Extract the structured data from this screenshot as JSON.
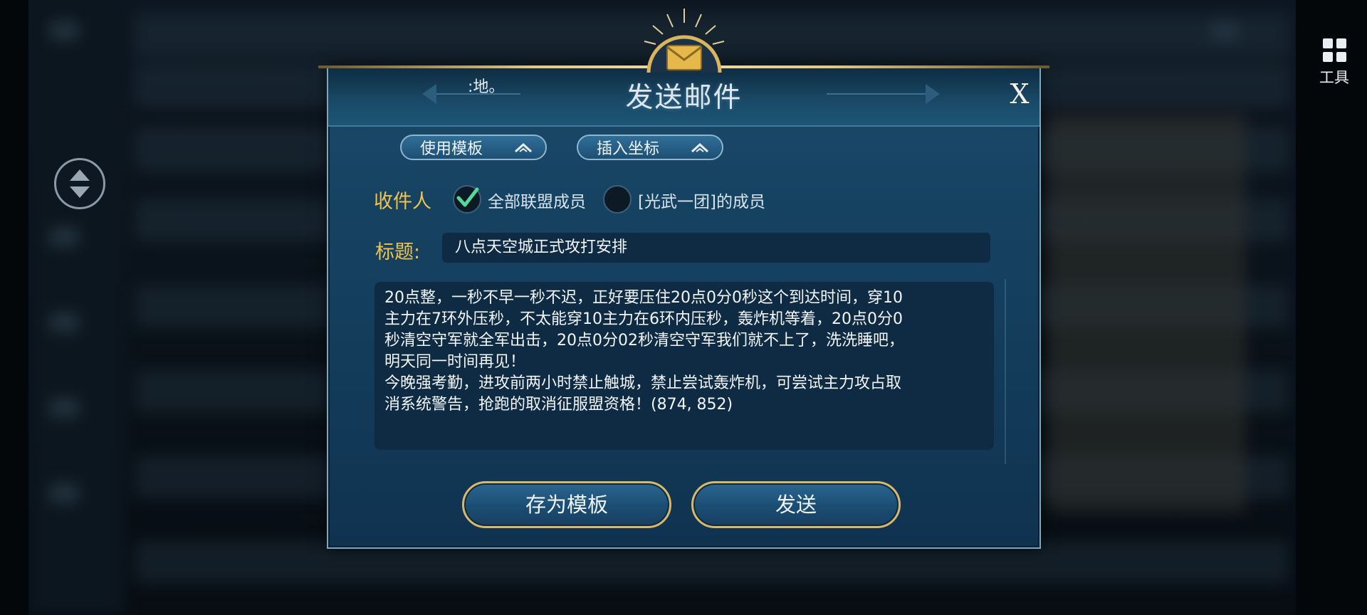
{
  "hud": {
    "tools_label": "工具"
  },
  "dialog": {
    "partial_text": ":地。",
    "title": "发送邮件",
    "close_label": "X",
    "use_template_label": "使用模板",
    "insert_coords_label": "插入坐标",
    "recipient_label": "收件人",
    "recipient_options": [
      {
        "label": "全部联盟成员",
        "checked": true
      },
      {
        "label": "[光武一团]的成员",
        "checked": false
      }
    ],
    "subject_label": "标题:",
    "subject_value": "八点天空城正式攻打安排",
    "body_lines": [
      "20点整，一秒不早一秒不迟，正好要压住20点0分0秒这个到达时间，穿10",
      "主力在7环外压秒，不太能穿10主力在6环内压秒，轰炸机等着，20点0分0",
      "秒清空守军就全军出击，20点0分02秒清空守军我们就不上了，洗洗睡吧，",
      "明天同一时间再见！",
      "今晚强考勤，进攻前两小时禁止触城，禁止尝试轰炸机，可尝试主力攻占取",
      "消系统警告，抢跑的取消征服盟资格！(874, 852)"
    ],
    "save_template_label": "存为模板",
    "send_label": "发送"
  },
  "colors": {
    "gold_label": "#f2c24e",
    "check_green": "#59d69a",
    "button_border_gold": "#d8b86a"
  }
}
